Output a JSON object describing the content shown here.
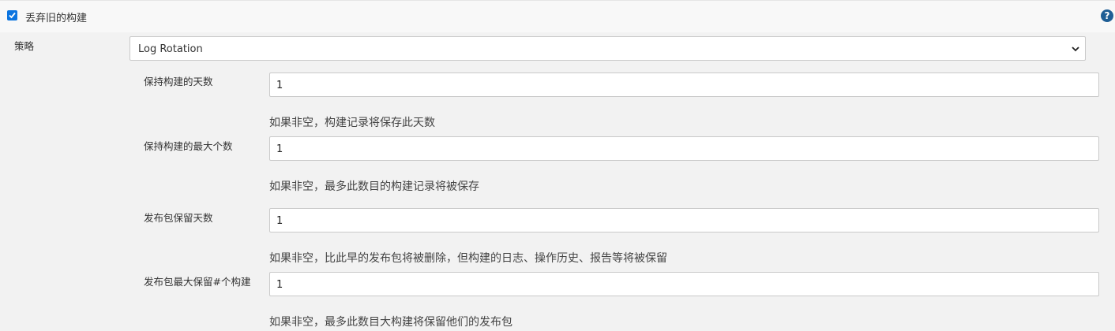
{
  "section": {
    "checkbox_checked": true,
    "label": "丢弃旧的构建",
    "help_glyph": "?"
  },
  "strategy": {
    "label": "策略",
    "selected": "Log Rotation"
  },
  "fields": [
    {
      "label": "保持构建的天数",
      "value": "1",
      "help": "如果非空，构建记录将保存此天数"
    },
    {
      "label": "保持构建的最大个数",
      "value": "1",
      "help": "如果非空，最多此数目的构建记录将被保存"
    },
    {
      "label": "发布包保留天数",
      "value": "1",
      "help": "如果非空，比此早的发布包将被删除，但构建的日志、操作历史、报告等将被保留"
    },
    {
      "label": "发布包最大保留#个构建",
      "value": "1",
      "help": "如果非空，最多此数目大构建将保留他们的发布包"
    }
  ],
  "colors": {
    "checkbox": "#0b74e0",
    "help_icon": "#1f5e95",
    "background": "#f2f2f2"
  }
}
